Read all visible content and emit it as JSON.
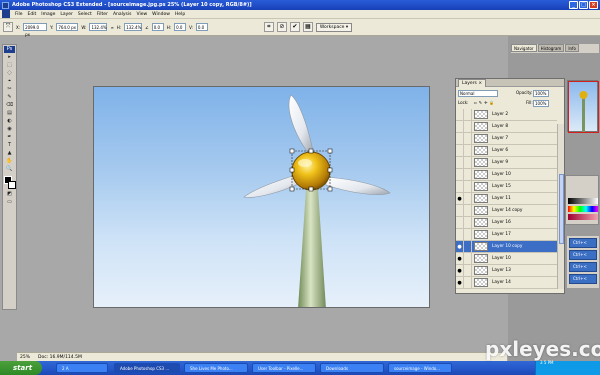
{
  "window": {
    "title": "Adobe Photoshop CS3 Extended - [sourceimage.jpg.ps 25% (Layer 10 copy, RGB/8#)]",
    "controls": [
      "_",
      "□",
      "×"
    ]
  },
  "menu": [
    "File",
    "Edit",
    "Image",
    "Layer",
    "Select",
    "Filter",
    "Analysis",
    "View",
    "Window",
    "Help"
  ],
  "options_bar": {
    "x_label": "X:",
    "x_value": "2099.0 px",
    "y_label": "Y:",
    "y_value": "764.0 px",
    "w_label": "W:",
    "w_value": "132.4%",
    "h_label": "H:",
    "h_value": "132.4%",
    "angle_value": "0.0",
    "h_skew_label": "H:",
    "h_skew_value": "0.0",
    "v_skew_label": "V:",
    "v_skew_value": "0.0",
    "workspace_label": "Workspace ▾"
  },
  "tools": [
    "▸",
    "⬚",
    "◌",
    "⌖",
    "✂",
    "✎",
    "⌫",
    "▤",
    "◐",
    "◉",
    "✒",
    "T",
    "▲",
    "✋",
    "🔍"
  ],
  "navigator": {
    "tabs": [
      "Navigator",
      "Histogram",
      "Info"
    ]
  },
  "layers_panel": {
    "tab": "Layers ×",
    "blend_mode": "Normal",
    "opacity_label": "Opacity:",
    "opacity_value": "100%",
    "lock_label": "Lock:",
    "fill_label": "Fill:",
    "fill_value": "100%",
    "rows": [
      {
        "name": "Layer 2",
        "visible": false,
        "selected": false
      },
      {
        "name": "Layer 8",
        "visible": false,
        "selected": false
      },
      {
        "name": "Layer 7",
        "visible": false,
        "selected": false
      },
      {
        "name": "Layer 6",
        "visible": false,
        "selected": false
      },
      {
        "name": "Layer 9",
        "visible": false,
        "selected": false
      },
      {
        "name": "Layer 10",
        "visible": false,
        "selected": false
      },
      {
        "name": "Layer 15",
        "visible": false,
        "selected": false
      },
      {
        "name": "Layer 11",
        "visible": true,
        "selected": false
      },
      {
        "name": "Layer 14 copy",
        "visible": false,
        "selected": false
      },
      {
        "name": "Layer 16",
        "visible": false,
        "selected": false
      },
      {
        "name": "Layer 17",
        "visible": false,
        "selected": false
      },
      {
        "name": "Layer 10 copy",
        "visible": true,
        "selected": true
      },
      {
        "name": "Layer 10",
        "visible": true,
        "selected": false
      },
      {
        "name": "Layer 13",
        "visible": true,
        "selected": false
      },
      {
        "name": "Layer 14",
        "visible": true,
        "selected": false
      }
    ]
  },
  "actions": [
    "Ctrl+<",
    "Ctrl+<",
    "Ctrl+<",
    "Ctrl+<"
  ],
  "status": {
    "zoom": "25%",
    "doc": "Doc: 16.9M/114.5M"
  },
  "taskbar": {
    "start": "start",
    "items": [
      {
        "label": "2 A",
        "active": false
      },
      {
        "label": "Adobe Photoshop CS3 ...",
        "active": true
      },
      {
        "label": "She Lives Me Photo...",
        "active": false
      },
      {
        "label": "User Toolbar - Pixelle...",
        "active": false
      },
      {
        "label": "Downloads",
        "active": false
      },
      {
        "label": "sourceimage - Windo...",
        "active": false
      }
    ]
  },
  "watermark": {
    "text": "pxleyes.com",
    "sub": "3 5 PM"
  },
  "colors": {
    "title_blue": "#2456c8",
    "selection_blue": "#3c6ec6",
    "sky_top": "#7fb2e9",
    "hub_gold": "#d8a312"
  }
}
